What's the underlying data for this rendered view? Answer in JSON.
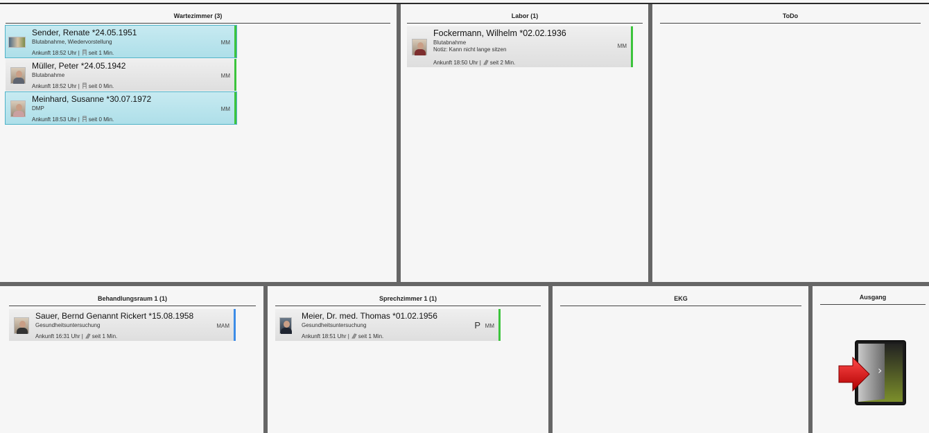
{
  "rooms": {
    "wartezimmer": {
      "title": "Wartezimmer (3)"
    },
    "labor": {
      "title": "Labor (1)"
    },
    "todo": {
      "title": "ToDo"
    },
    "behandlung": {
      "title": "Behandlungsraum 1 (1)"
    },
    "sprech": {
      "title": "Sprechzimmer 1 (1)"
    },
    "ekg": {
      "title": "EKG"
    },
    "ausgang": {
      "title": "Ausgang"
    }
  },
  "patients": {
    "sender": {
      "name": "Sender, Renate *24.05.1951",
      "reason": "Blutabnahme, Wiedervorstellung",
      "arrival": "Ankunft 18:52 Uhr |",
      "since": "seit 1 Min.",
      "staff": "MM"
    },
    "mueller": {
      "name": "Müller, Peter *24.05.1942",
      "reason": "Blutabnahme",
      "arrival": "Ankunft 18:52 Uhr |",
      "since": "seit 0 Min.",
      "staff": "MM"
    },
    "meinhard": {
      "name": "Meinhard, Susanne *30.07.1972",
      "reason": "DMP",
      "arrival": "Ankunft 18:53 Uhr |",
      "since": "seit 0 Min.",
      "staff": "MM"
    },
    "fockermann": {
      "name": "Fockermann, Wilhelm *02.02.1936",
      "reason": "Blutabnahme",
      "note": "Notiz: Kann nicht lange sitzen",
      "arrival": "Ankunft 18:50 Uhr |",
      "since": "seit 2 Min.",
      "staff": "MM"
    },
    "sauer": {
      "name": "Sauer, Bernd Genannt Rickert *15.08.1958",
      "reason": "Gesundheitsuntersuchung",
      "arrival": "Ankunft 16:31 Uhr |",
      "since": "seit 1 Min.",
      "staff": "MAM"
    },
    "meier": {
      "name": "Meier, Dr. med. Thomas *01.02.1956",
      "reason": "Gesundheitsuntersuchung",
      "arrival": "Ankunft 18:51 Uhr |",
      "since": "seit 1 Min.",
      "staff": "MM",
      "priority": "P"
    }
  },
  "colors": {
    "status_green": "#3cc43c",
    "status_blue": "#3c8ce7",
    "selected_bg": "#b8e3ec",
    "separator": "#666666"
  },
  "icons": {
    "chair": "chair-icon",
    "exit": "exit-door-icon"
  }
}
